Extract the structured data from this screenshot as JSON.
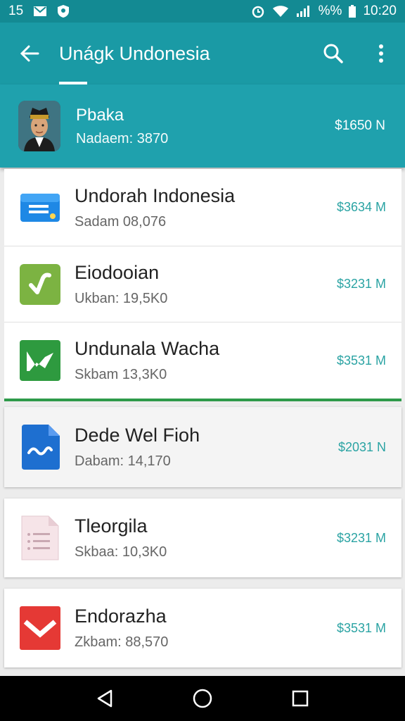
{
  "status_bar": {
    "time_left": "15",
    "battery_pct": "%%",
    "time_right": "10:20"
  },
  "app_bar": {
    "title": "Unágk Undonesia",
    "icons": [
      "back-arrow-icon",
      "search-icon",
      "more-vert-icon"
    ]
  },
  "profile": {
    "name": "Pbaka",
    "subtitle": "Nadaem: 3870",
    "amount": "$1650 N"
  },
  "items": [
    {
      "name": "Undorah Indonesia",
      "subtitle": "Sadam 08,076",
      "amount": "$3634 M",
      "icon": "wallet-card-icon",
      "color": "#1e88e5"
    },
    {
      "name": "Eiodooian",
      "subtitle": "Ukban: 19,5K0",
      "amount": "$3231 M",
      "icon": "check-app-icon",
      "color": "#7cb342"
    },
    {
      "name": "Undunala Wacha",
      "subtitle": "Skbam 13,3K0",
      "amount": "$3531 M",
      "icon": "green-mail-icon",
      "color": "#2e9a3f"
    },
    {
      "name": "Dede Wel Fioh",
      "subtitle": "Dabam: 14,170",
      "amount": "$2031 N",
      "icon": "wave-document-icon",
      "color": "#1e6fd0"
    },
    {
      "name": "Tleorgila",
      "subtitle": "Skbaa: 10,3K0",
      "amount": "$3231 M",
      "icon": "list-document-icon",
      "color": "#f3dfe4"
    },
    {
      "name": "Endorazha",
      "subtitle": "Zkbam: 88,570",
      "amount": "$3531 M",
      "icon": "red-mail-icon",
      "color": "#e53935"
    }
  ],
  "nav_bar": {
    "icons": [
      "back-triangle-icon",
      "home-circle-icon",
      "recents-square-icon"
    ]
  }
}
